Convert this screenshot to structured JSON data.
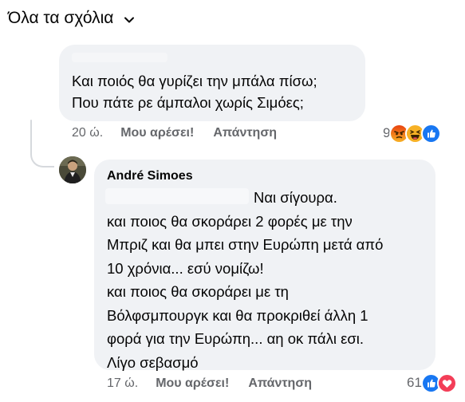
{
  "header": {
    "title": "Όλα τα σχόλια",
    "chevron_icon": "chevron-down-icon"
  },
  "comments": [
    {
      "author": "",
      "lines": [
        "Και ποιός θα γυρίζει την μπάλα πίσω;",
        "Που πάτε ρε άμπαλοι χωρίς Σιμόες;"
      ],
      "time": "20 ώ.",
      "like_label": "Μου αρέσει!",
      "reply_label": "Απάντηση",
      "reaction_count": "9",
      "reactions": [
        "angry-icon",
        "haha-icon",
        "like-icon"
      ]
    }
  ],
  "reply": {
    "author": "André Simoes",
    "lines": [
      "Ναι σίγουρα.",
      "και ποιος θα σκοράρει 2 φορές με την",
      "Μπριζ και θα μπει στην Ευρώπη μετά από",
      "10 χρόνια... εσύ νομίζω!",
      "και ποιος θα σκοράρει με τη",
      "Βόλφσμπουργκ και θα προκριθεί άλλη 1",
      "φορά για την Ευρώπη... αη οκ πάλι εσι.",
      "Λίγο σεβασμό"
    ],
    "time": "17 ώ.",
    "like_label": "Μου αρέσει!",
    "reply_label": "Απάντηση",
    "reaction_count": "61",
    "reactions": [
      "like-icon",
      "love-icon"
    ]
  },
  "colors": {
    "bubble": "#f0f2f5",
    "meta_text": "#65676b",
    "like_blue": "#1877f2",
    "love_red": "#f33e58",
    "angry_orange": "#e9710f",
    "haha_yellow": "#f7b125"
  }
}
